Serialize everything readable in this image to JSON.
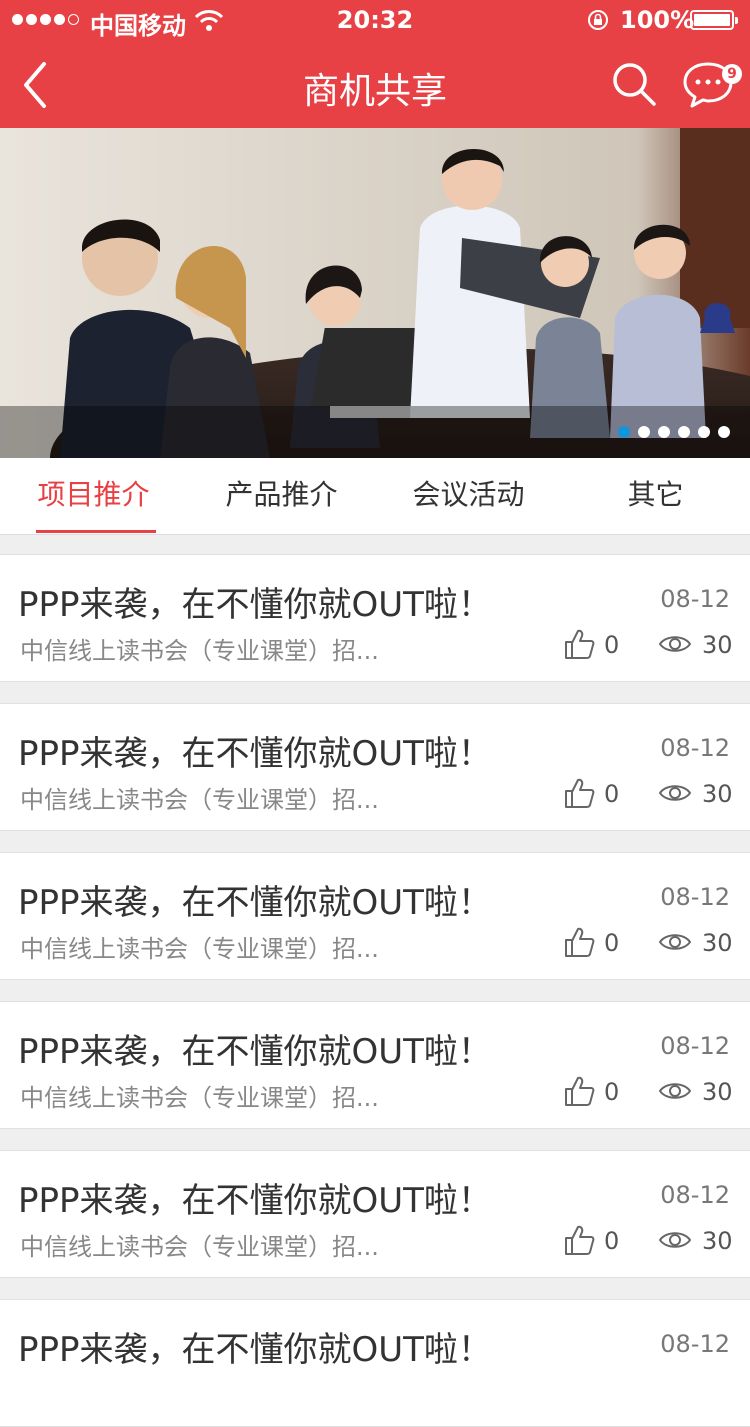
{
  "status_bar": {
    "carrier": "中国移动",
    "time": "20:32",
    "battery": "100%"
  },
  "nav": {
    "title": "商机共享",
    "message_badge": "9",
    "icons": [
      "back-chevron-icon",
      "search-icon",
      "message-bubble-icon"
    ]
  },
  "banner": {
    "slide_count": 6,
    "active_index": 0
  },
  "tabs": [
    {
      "label": "项目推介",
      "active": true
    },
    {
      "label": "产品推介",
      "active": false
    },
    {
      "label": "会议活动",
      "active": false
    },
    {
      "label": "其它",
      "active": false
    }
  ],
  "items": [
    {
      "title": "PPP来袭，在不懂你就OUT啦！",
      "date": "08-12",
      "summary": "中信线上读书会（专业课堂）招...",
      "likes": "0",
      "views": "30"
    },
    {
      "title": "PPP来袭，在不懂你就OUT啦！",
      "date": "08-12",
      "summary": "中信线上读书会（专业课堂）招...",
      "likes": "0",
      "views": "30"
    },
    {
      "title": "PPP来袭，在不懂你就OUT啦！",
      "date": "08-12",
      "summary": "中信线上读书会（专业课堂）招...",
      "likes": "0",
      "views": "30"
    },
    {
      "title": "PPP来袭，在不懂你就OUT啦！",
      "date": "08-12",
      "summary": "中信线上读书会（专业课堂）招...",
      "likes": "0",
      "views": "30"
    },
    {
      "title": "PPP来袭，在不懂你就OUT啦！",
      "date": "08-12",
      "summary": "中信线上读书会（专业课堂）招...",
      "likes": "0",
      "views": "30"
    },
    {
      "title": "PPP来袭，在不懂你就OUT啦！",
      "date": "08-12",
      "summary": "",
      "likes": "",
      "views": ""
    }
  ],
  "colors": {
    "brand": "#e84145",
    "active_dot": "#1296db"
  }
}
